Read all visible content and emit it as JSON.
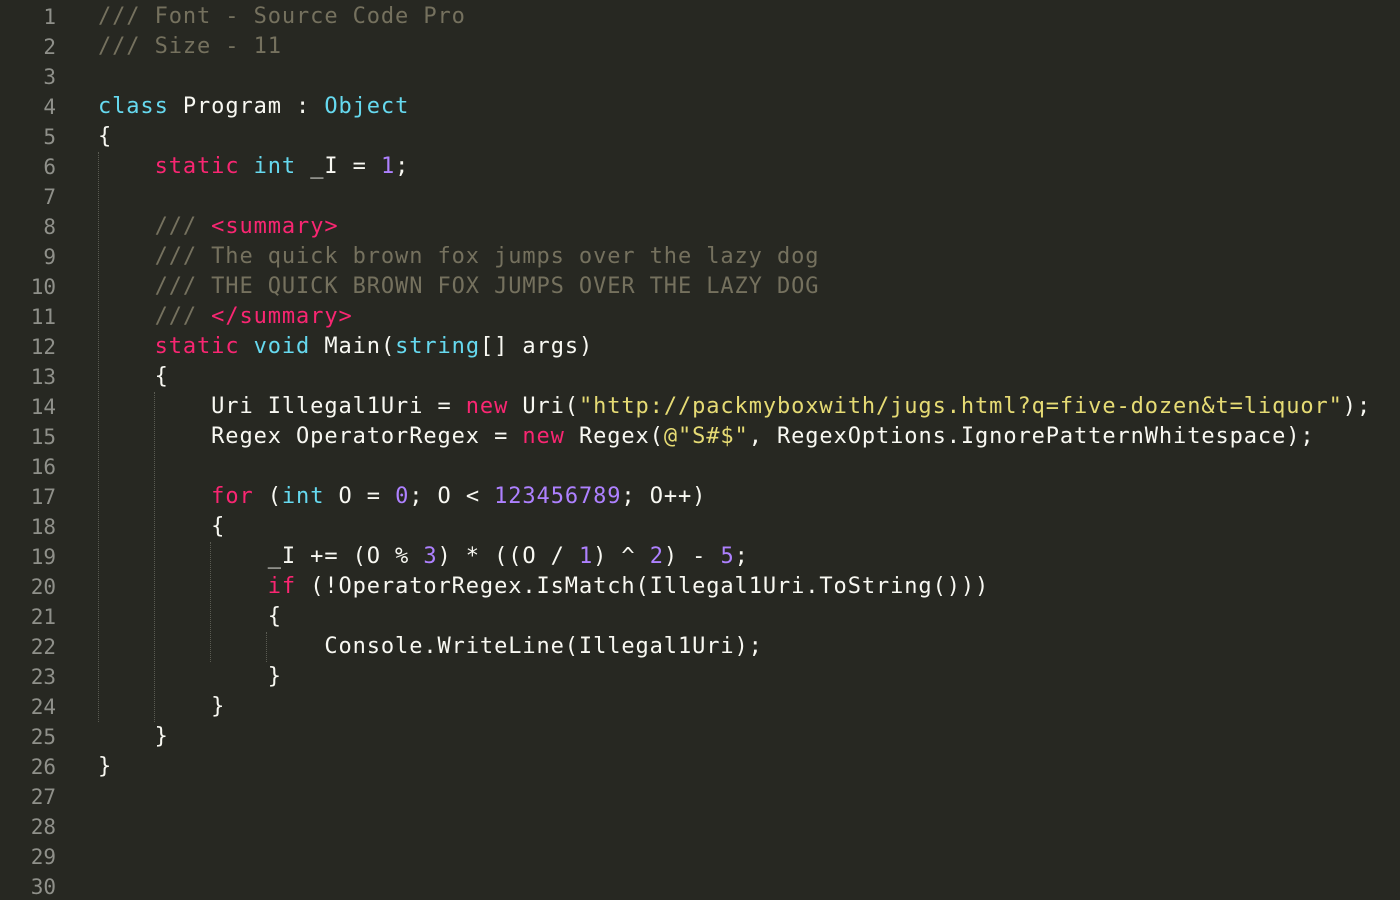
{
  "editor": {
    "background": "#272822",
    "theme_colors": {
      "comment": "#75715e",
      "keyword": "#f92672",
      "type": "#66d9ef",
      "number": "#ae81ff",
      "string": "#e6db74",
      "text": "#f8f8f2",
      "line_number": "#8f908a"
    },
    "line_numbers": [
      "1",
      "2",
      "3",
      "4",
      "5",
      "6",
      "7",
      "8",
      "9",
      "10",
      "11",
      "12",
      "13",
      "14",
      "15",
      "16",
      "17",
      "18",
      "19",
      "20",
      "21",
      "22",
      "23",
      "24",
      "25",
      "26",
      "27",
      "28",
      "29",
      "30"
    ],
    "lines": [
      [
        {
          "t": "/// Font - Source Code Pro",
          "c": "cm"
        }
      ],
      [
        {
          "t": "/// Size - 11",
          "c": "cm"
        }
      ],
      [],
      [
        {
          "t": "class",
          "c": "ty"
        },
        {
          "t": " Program : ",
          "c": "tx"
        },
        {
          "t": "Object",
          "c": "ty"
        }
      ],
      [
        {
          "t": "{",
          "c": "tx"
        }
      ],
      [
        {
          "t": "    ",
          "c": "tx"
        },
        {
          "t": "static",
          "c": "kw"
        },
        {
          "t": " ",
          "c": "tx"
        },
        {
          "t": "int",
          "c": "ty"
        },
        {
          "t": " _I = ",
          "c": "tx"
        },
        {
          "t": "1",
          "c": "nu"
        },
        {
          "t": ";",
          "c": "tx"
        }
      ],
      [],
      [
        {
          "t": "    /// ",
          "c": "cm"
        },
        {
          "t": "<summary>",
          "c": "kw"
        }
      ],
      [
        {
          "t": "    /// The quick brown fox jumps over the lazy dog",
          "c": "cm"
        }
      ],
      [
        {
          "t": "    /// THE QUICK BROWN FOX JUMPS OVER THE LAZY DOG",
          "c": "cm"
        }
      ],
      [
        {
          "t": "    /// ",
          "c": "cm"
        },
        {
          "t": "</summary>",
          "c": "kw"
        }
      ],
      [
        {
          "t": "    ",
          "c": "tx"
        },
        {
          "t": "static",
          "c": "kw"
        },
        {
          "t": " ",
          "c": "tx"
        },
        {
          "t": "void",
          "c": "ty"
        },
        {
          "t": " Main(",
          "c": "tx"
        },
        {
          "t": "string",
          "c": "ty"
        },
        {
          "t": "[] args)",
          "c": "tx"
        }
      ],
      [
        {
          "t": "    {",
          "c": "tx"
        }
      ],
      [
        {
          "t": "        Uri Illegal1Uri = ",
          "c": "tx"
        },
        {
          "t": "new",
          "c": "kw"
        },
        {
          "t": " Uri(",
          "c": "tx"
        },
        {
          "t": "\"http://packmyboxwith/jugs.html?q=five-dozen&t=liquor\"",
          "c": "st"
        },
        {
          "t": ");",
          "c": "tx"
        }
      ],
      [
        {
          "t": "        Regex OperatorRegex = ",
          "c": "tx"
        },
        {
          "t": "new",
          "c": "kw"
        },
        {
          "t": " Regex(",
          "c": "tx"
        },
        {
          "t": "@\"S#$\"",
          "c": "st"
        },
        {
          "t": ", RegexOptions.IgnorePatternWhitespace);",
          "c": "tx"
        }
      ],
      [],
      [
        {
          "t": "        ",
          "c": "tx"
        },
        {
          "t": "for",
          "c": "kw"
        },
        {
          "t": " (",
          "c": "tx"
        },
        {
          "t": "int",
          "c": "ty"
        },
        {
          "t": " O = ",
          "c": "tx"
        },
        {
          "t": "0",
          "c": "nu"
        },
        {
          "t": "; O < ",
          "c": "tx"
        },
        {
          "t": "123456789",
          "c": "nu"
        },
        {
          "t": "; O++)",
          "c": "tx"
        }
      ],
      [
        {
          "t": "        {",
          "c": "tx"
        }
      ],
      [
        {
          "t": "            _I += (O % ",
          "c": "tx"
        },
        {
          "t": "3",
          "c": "nu"
        },
        {
          "t": ") * ((O / ",
          "c": "tx"
        },
        {
          "t": "1",
          "c": "nu"
        },
        {
          "t": ") ^ ",
          "c": "tx"
        },
        {
          "t": "2",
          "c": "nu"
        },
        {
          "t": ") - ",
          "c": "tx"
        },
        {
          "t": "5",
          "c": "nu"
        },
        {
          "t": ";",
          "c": "tx"
        }
      ],
      [
        {
          "t": "            ",
          "c": "tx"
        },
        {
          "t": "if",
          "c": "kw"
        },
        {
          "t": " (!OperatorRegex.IsMatch(Illegal1Uri.ToString()))",
          "c": "tx"
        }
      ],
      [
        {
          "t": "            {",
          "c": "tx"
        }
      ],
      [
        {
          "t": "                Console.WriteLine(Illegal1Uri);",
          "c": "tx"
        }
      ],
      [
        {
          "t": "            }",
          "c": "tx"
        }
      ],
      [
        {
          "t": "        }",
          "c": "tx"
        }
      ],
      [
        {
          "t": "    }",
          "c": "tx"
        }
      ],
      [
        {
          "t": "}",
          "c": "tx"
        }
      ],
      [],
      [],
      [],
      []
    ]
  }
}
